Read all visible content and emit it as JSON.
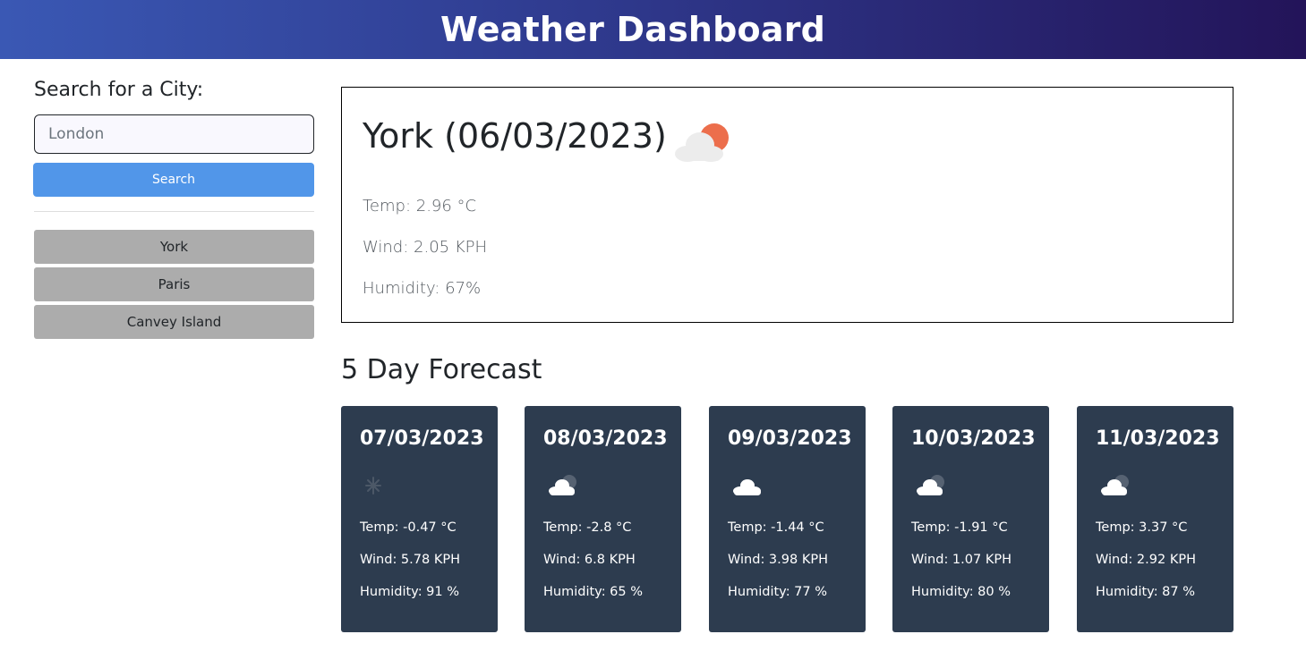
{
  "header": {
    "title": "Weather Dashboard"
  },
  "sidebar": {
    "title": "Search for a City:",
    "search": {
      "placeholder": "London",
      "value": ""
    },
    "search_button_label": "Search",
    "history": [
      "York",
      "Paris",
      "Canvey Island"
    ]
  },
  "current": {
    "title": "York (06/03/2023)",
    "icon": "partly-cloudy-day-icon",
    "temp": "Temp: 2.96 °C",
    "wind": "Wind: 2.05 KPH",
    "humidity": "Humidity: 67%"
  },
  "forecast": {
    "title": "5 Day Forecast",
    "days": [
      {
        "date": "07/03/2023",
        "icon": "snow-icon",
        "temp": "Temp: -0.47 °C",
        "wind": "Wind: 5.78 KPH",
        "humidity": "Humidity: 91 %"
      },
      {
        "date": "08/03/2023",
        "icon": "cloudy-night-icon",
        "temp": "Temp: -2.8 °C",
        "wind": "Wind: 6.8 KPH",
        "humidity": "Humidity: 65 %"
      },
      {
        "date": "09/03/2023",
        "icon": "cloud-icon",
        "temp": "Temp: -1.44 °C",
        "wind": "Wind: 3.98 KPH",
        "humidity": "Humidity: 77 %"
      },
      {
        "date": "10/03/2023",
        "icon": "cloudy-night-icon",
        "temp": "Temp: -1.91 °C",
        "wind": "Wind: 1.07 KPH",
        "humidity": "Humidity: 80 %"
      },
      {
        "date": "11/03/2023",
        "icon": "cloudy-night-icon",
        "temp": "Temp: 3.37 °C",
        "wind": "Wind: 2.92 KPH",
        "humidity": "Humidity: 87 %"
      }
    ]
  },
  "colors": {
    "header_gradient": [
      "#3a58b4",
      "#231459"
    ],
    "search_button": "#5196e9",
    "history_button": "#acacac",
    "forecast_card": "#2d3c4f",
    "sun": "#ec6e4c"
  }
}
